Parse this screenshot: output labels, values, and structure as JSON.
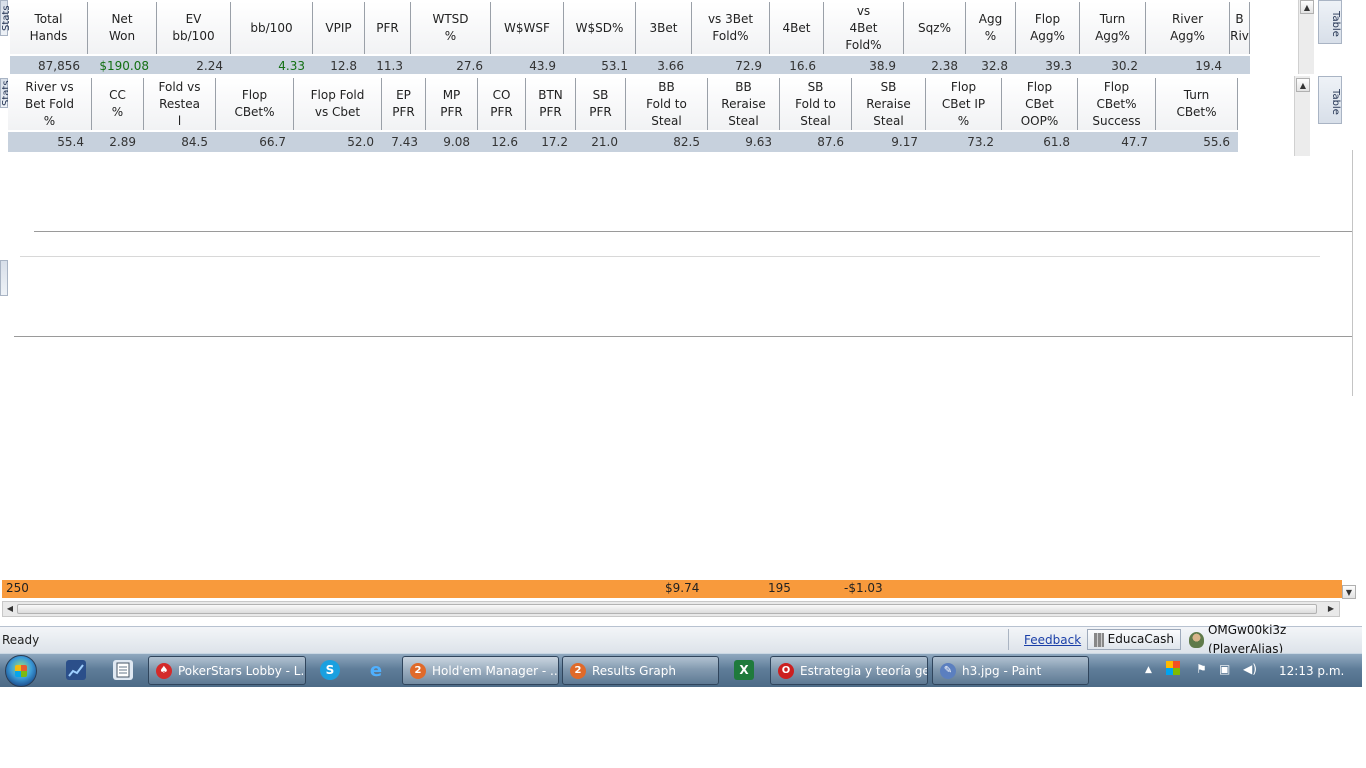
{
  "side_tabs": {
    "left_top": "Stats",
    "left_mid": "Stats",
    "right_top": "Table",
    "right_mid": "Table"
  },
  "table1": {
    "headers": [
      "Total\nHands",
      "Net\nWon",
      "EV\nbb/100",
      "bb/100",
      "VPIP",
      "PFR",
      "WTSD\n%",
      "W$WSF",
      "W$SD%",
      "3Bet",
      "vs 3Bet\nFold%",
      "4Bet",
      "vs\n4Bet\nFold%",
      "Sqz%",
      "Agg\n%",
      "Flop\nAgg%",
      "Turn\nAgg%",
      "River\nAgg%",
      "B\nRiv"
    ],
    "values": [
      "87,856",
      "$190.08",
      "2.24",
      "4.33",
      "12.8",
      "11.3",
      "27.6",
      "43.9",
      "53.1",
      "3.66",
      "72.9",
      "16.6",
      "38.9",
      "2.38",
      "32.8",
      "39.3",
      "30.2",
      "19.4",
      ""
    ]
  },
  "table2": {
    "headers": [
      "River vs\nBet Fold\n%",
      "CC\n%",
      "Fold vs\nRestea\nl",
      "Flop\nCBet%",
      "Flop Fold\nvs Cbet",
      "EP\nPFR",
      "MP\nPFR",
      "CO\nPFR",
      "BTN\nPFR",
      "SB\nPFR",
      "BB\nFold to\nSteal",
      "BB\nReraise\nSteal",
      "SB\nFold to\nSteal",
      "SB\nReraise\nSteal",
      "Flop\nCBet IP\n%",
      "Flop\nCBet\nOOP%",
      "Flop\nCBet%\nSuccess",
      "Turn\nCBet%"
    ],
    "values": [
      "55.4",
      "2.89",
      "84.5",
      "66.7",
      "52.0",
      "7.43",
      "9.08",
      "12.6",
      "17.2",
      "21.0",
      "82.5",
      "9.63",
      "87.6",
      "9.17",
      "73.2",
      "61.8",
      "47.7",
      "55.6"
    ]
  },
  "orange_row": {
    "hands": "250",
    "amount": "$9.74",
    "count": "195",
    "ev": "-$1.03"
  },
  "status": {
    "text": "Ready",
    "feedback": "Feedback",
    "educacash": "EducaCash",
    "player": "OMGw00ki3z (PlayerAlias)"
  },
  "taskbar": {
    "buttons": [
      {
        "label": "PokerStars Lobby - L...",
        "icon": "pokerstars-icon",
        "color": "#d42a2a"
      },
      {
        "label": "Hold'em Manager - ...",
        "icon": "holdem-manager-icon",
        "color": "#e06a2a"
      },
      {
        "label": "Results Graph",
        "icon": "holdem-manager-icon",
        "color": "#e06a2a"
      },
      {
        "label": "Estrategia y teoría ge...",
        "icon": "opera-icon",
        "color": "#cc1f1f"
      },
      {
        "label": "h3.jpg - Paint",
        "icon": "paint-icon",
        "color": "#5b7fbf"
      }
    ],
    "clock": "12:13 p.m."
  }
}
